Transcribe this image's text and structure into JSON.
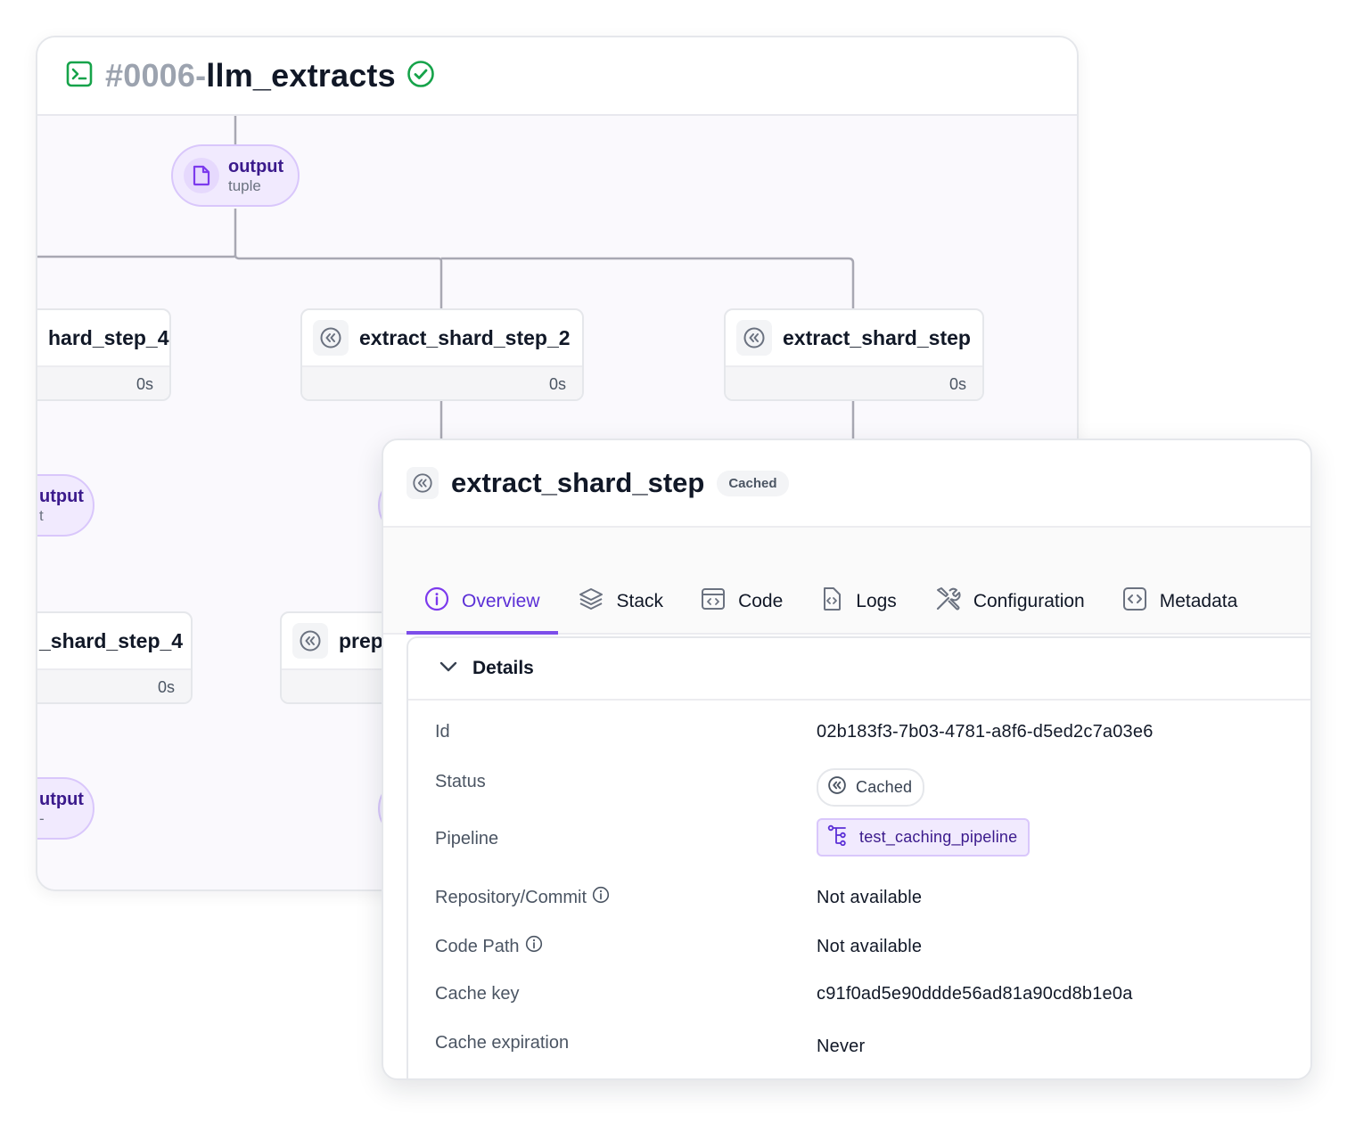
{
  "run": {
    "number": "#0006-",
    "name": "llm_extracts"
  },
  "dag": {
    "artifacts": [
      {
        "name": "output",
        "type": "tuple"
      },
      {
        "name": "utput",
        "type": "t"
      },
      {
        "name": "utput",
        "type": "-"
      }
    ],
    "steps": [
      {
        "name": "hard_step_4",
        "duration": "0s"
      },
      {
        "name": "extract_shard_step_2",
        "duration": "0s"
      },
      {
        "name": "extract_shard_step",
        "duration": "0s"
      },
      {
        "name": "_shard_step_4",
        "duration": "0s"
      },
      {
        "name": "prep",
        "duration": ""
      }
    ]
  },
  "detail": {
    "title": "extract_shard_step",
    "badge": "Cached",
    "tabs": [
      {
        "label": "Overview",
        "icon": "info-icon",
        "active": true
      },
      {
        "label": "Stack",
        "icon": "layers-icon",
        "active": false
      },
      {
        "label": "Code",
        "icon": "code-window-icon",
        "active": false
      },
      {
        "label": "Logs",
        "icon": "log-file-icon",
        "active": false
      },
      {
        "label": "Configuration",
        "icon": "tools-icon",
        "active": false
      },
      {
        "label": "Metadata",
        "icon": "metadata-icon",
        "active": false
      }
    ],
    "section_title": "Details",
    "rows": {
      "id": {
        "label": "Id",
        "value": "02b183f3-7b03-4781-a8f6-d5ed2c7a03e6"
      },
      "status": {
        "label": "Status",
        "value": "Cached"
      },
      "pipeline": {
        "label": "Pipeline",
        "value": "test_caching_pipeline"
      },
      "repo": {
        "label": "Repository/Commit",
        "value": "Not available"
      },
      "code_path": {
        "label": "Code Path",
        "value": "Not available"
      },
      "cache_key": {
        "label": "Cache key",
        "value": "c91f0ad5e90ddde56ad81a90cd8b1e0a"
      },
      "cache_exp": {
        "label": "Cache expiration",
        "value": "Never"
      }
    }
  },
  "colors": {
    "accent": "#7c4dea",
    "success": "#16a34a",
    "artifact_bg": "#f1eafe"
  }
}
